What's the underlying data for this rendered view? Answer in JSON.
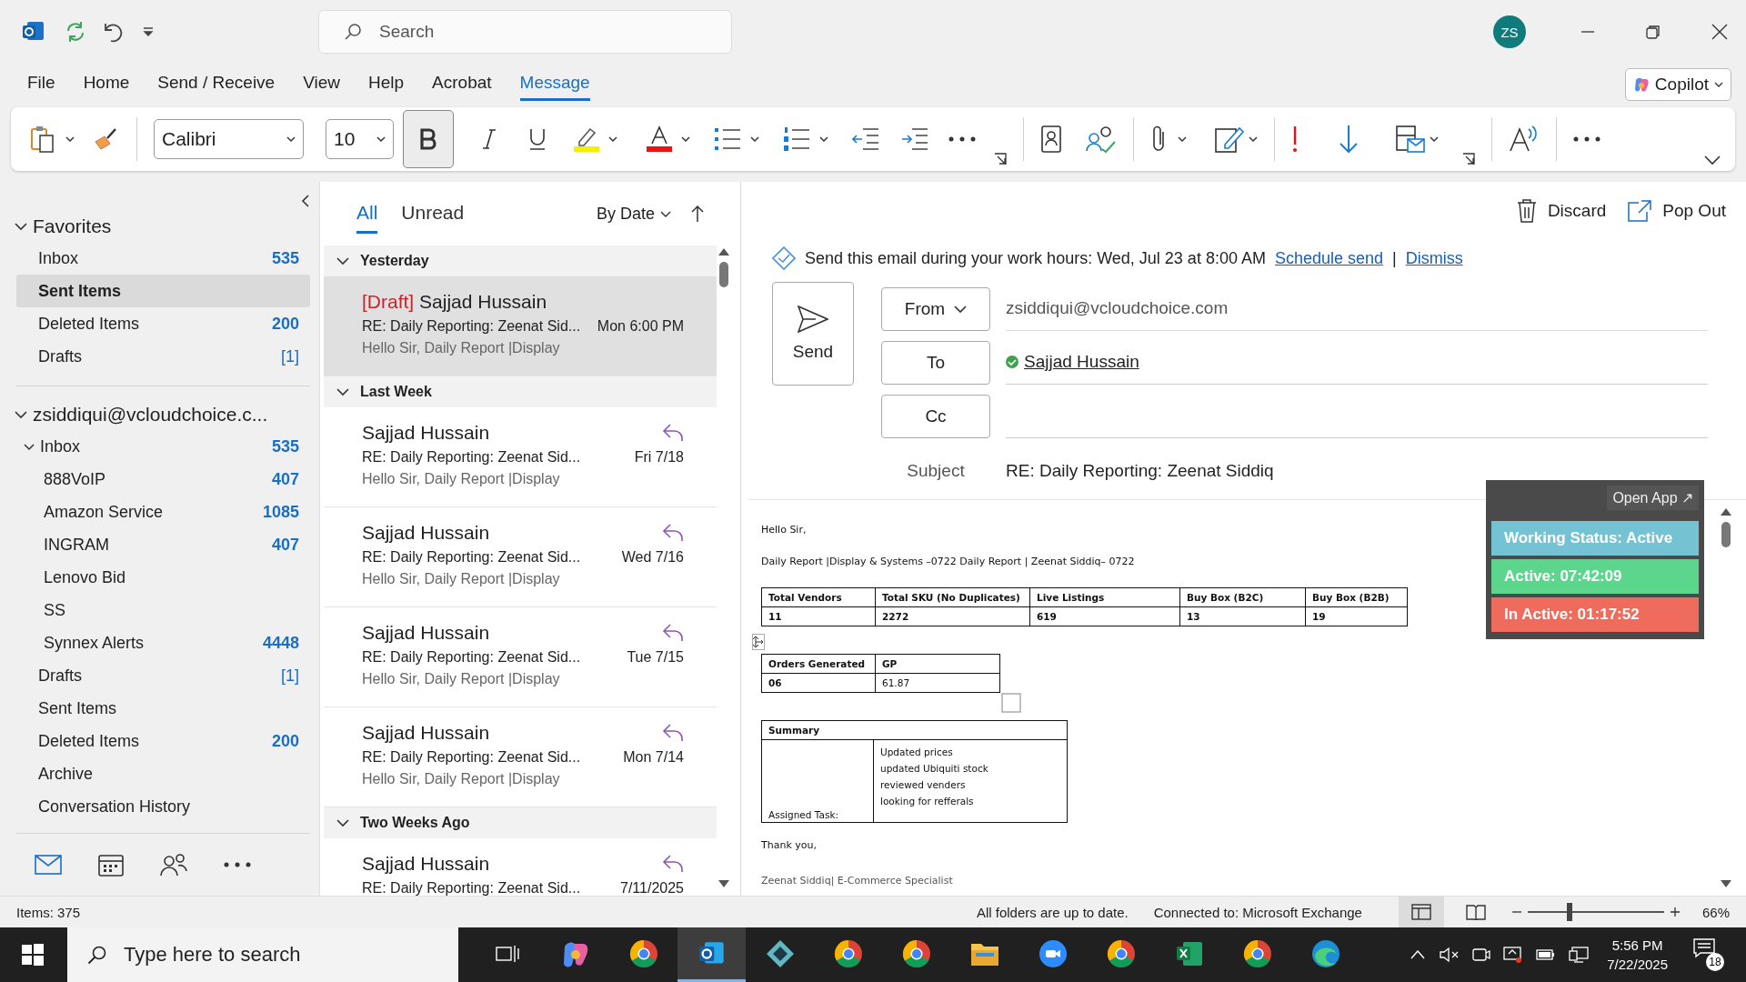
{
  "window": {
    "search_placeholder": "Search",
    "avatar": "ZS"
  },
  "menu": [
    {
      "label": "File",
      "selected": false
    },
    {
      "label": "Home",
      "selected": false
    },
    {
      "label": "Send / Receive",
      "selected": false
    },
    {
      "label": "View",
      "selected": false
    },
    {
      "label": "Help",
      "selected": false
    },
    {
      "label": "Acrobat",
      "selected": false
    },
    {
      "label": "Message",
      "selected": true
    }
  ],
  "copilot": "Copilot",
  "ribbon": {
    "font": "Calibri",
    "size": "10",
    "bold_active": true
  },
  "folders": {
    "favorites": {
      "title": "Favorites",
      "expanded": true,
      "items": [
        {
          "name": "Inbox",
          "count": "535",
          "kind": "unread",
          "selected": false
        },
        {
          "name": "Sent Items",
          "selected": true
        },
        {
          "name": "Deleted Items",
          "count": "200",
          "kind": "unread",
          "selected": false
        },
        {
          "name": "Drafts",
          "count": "[1]",
          "kind": "drafts",
          "selected": false
        }
      ]
    },
    "account": {
      "title": "zsiddiqui@vcloudchoice.c...",
      "expanded": true,
      "items": [
        {
          "name": "Inbox",
          "count": "535",
          "kind": "unread",
          "selected": false,
          "expanded": true,
          "children": [
            {
              "name": "888VoIP",
              "count": "407",
              "kind": "unread",
              "selected": false
            },
            {
              "name": "Amazon Service",
              "count": "1085",
              "kind": "unread",
              "selected": false
            },
            {
              "name": "INGRAM",
              "count": "407",
              "kind": "unread",
              "selected": false
            },
            {
              "name": "Lenovo Bid",
              "selected": false
            },
            {
              "name": "SS",
              "selected": false
            },
            {
              "name": "Synnex Alerts",
              "count": "4448",
              "kind": "unread",
              "selected": false
            }
          ]
        },
        {
          "name": "Drafts",
          "count": "[1]",
          "kind": "drafts",
          "selected": false
        },
        {
          "name": "Sent Items",
          "selected": false
        },
        {
          "name": "Deleted Items",
          "count": "200",
          "kind": "unread",
          "selected": false
        },
        {
          "name": "Archive",
          "selected": false
        },
        {
          "name": "Conversation History",
          "selected": false
        }
      ]
    }
  },
  "messages": {
    "filters": [
      {
        "label": "All",
        "selected": true
      },
      {
        "label": "Unread",
        "selected": false
      }
    ],
    "sort": "By Date",
    "groups": [
      {
        "title": "Yesterday",
        "expanded": true,
        "items": [
          {
            "tag": "[Draft]",
            "sender": "Sajjad Hussain",
            "subject": "RE: Daily Reporting: Zeenat Sid...",
            "date": "Mon 6:00 PM",
            "preview": "Hello Sir,  Daily Report |Display",
            "replied": false,
            "selected": true
          }
        ]
      },
      {
        "title": "Last Week",
        "expanded": true,
        "items": [
          {
            "sender": "Sajjad Hussain",
            "subject": "RE: Daily Reporting: Zeenat Sid...",
            "date": "Fri 7/18",
            "preview": "Hello Sir,  Daily Report |Display",
            "replied": true,
            "selected": false
          },
          {
            "sender": "Sajjad Hussain",
            "subject": "RE: Daily Reporting: Zeenat Sid...",
            "date": "Wed 7/16",
            "preview": "Hello Sir,  Daily Report |Display",
            "replied": true,
            "selected": false
          },
          {
            "sender": "Sajjad Hussain",
            "subject": "RE: Daily Reporting: Zeenat Sid...",
            "date": "Tue 7/15",
            "preview": "Hello Sir,  Daily Report |Display",
            "replied": true,
            "selected": false
          },
          {
            "sender": "Sajjad Hussain",
            "subject": "RE: Daily Reporting: Zeenat Sid...",
            "date": "Mon 7/14",
            "preview": "Hello Sir,  Daily Report |Display",
            "replied": true,
            "selected": false
          }
        ]
      },
      {
        "title": "Two Weeks Ago",
        "expanded": true,
        "items": [
          {
            "sender": "Sajjad Hussain",
            "subject": "RE: Daily Reporting: Zeenat Sid...",
            "date": "7/11/2025",
            "replied": true,
            "selected": false
          }
        ]
      }
    ]
  },
  "compose": {
    "discard": "Discard",
    "pop_out": "Pop Out",
    "notice": "Send this email during your work hours: Wed, Jul 23 at 8:00 AM",
    "schedule_link": "Schedule send",
    "separator": "|",
    "dismiss_link": "Dismiss",
    "send": "Send",
    "from_label": "From",
    "from_value": "zsiddiqui@vcloudchoice.com",
    "to_label": "To",
    "recipients": [
      {
        "name": "Sajjad Hussain"
      }
    ],
    "cc_label": "Cc",
    "subject_label": "Subject",
    "subject": "RE: Daily Reporting: Zeenat Siddiq"
  },
  "body": {
    "greeting": "Hello Sir,",
    "line": "Daily Report |Display & Systems –0722 Daily Report | Zeenat Siddiq– 0722",
    "table1": {
      "columns": [
        "Total Vendors",
        "Total SKU (No Duplicates)",
        "Live Listings",
        "Buy Box (B2C)",
        "Buy Box (B2B)"
      ],
      "rows": [
        [
          "11",
          "2272",
          "619",
          "13",
          "19"
        ]
      ]
    },
    "table2": {
      "columns": [
        "Orders Generated",
        "GP"
      ],
      "rows": [
        [
          "06",
          "61.87"
        ]
      ]
    },
    "summary": {
      "title": "Summary",
      "label": "Assigned Task:",
      "tasks": [
        "Updated prices",
        "updated Ubiquiti stock",
        "reviewed venders",
        "looking for refferals"
      ]
    },
    "closing": "Thank you,",
    "signature": "Zeenat Siddiq| E-Commerce Specialist"
  },
  "widget": {
    "open_app": "Open App ↗",
    "rows": [
      {
        "text": "Working Status: Active",
        "color": "#74c3d4"
      },
      {
        "text": "Active: 07:42:09",
        "color": "#5cd68d"
      },
      {
        "text": "In Active: 01:17:52",
        "color": "#ef6c5c"
      }
    ]
  },
  "status": {
    "items": "Items: 375",
    "sync": "All folders are up to date.",
    "connection": "Connected to: Microsoft Exchange",
    "zoom": {
      "level": 0.31,
      "reading": "66%"
    }
  },
  "taskbar": {
    "search_placeholder": "Type here to search",
    "apps": [
      {
        "kind": "taskview",
        "selected": false
      },
      {
        "kind": "copilot",
        "selected": false
      },
      {
        "kind": "chrome",
        "selected": false
      },
      {
        "kind": "outlook",
        "selected": true
      },
      {
        "kind": "diamond",
        "selected": false
      },
      {
        "kind": "chrome",
        "selected": false
      },
      {
        "kind": "chrome",
        "selected": false
      },
      {
        "kind": "files",
        "selected": false
      },
      {
        "kind": "zoom",
        "selected": false
      },
      {
        "kind": "chrome",
        "selected": false
      },
      {
        "kind": "excel",
        "selected": false
      },
      {
        "kind": "chrome",
        "selected": false
      },
      {
        "kind": "edge",
        "selected": false
      }
    ],
    "time": "5:56 PM",
    "date": "7/22/2025",
    "notifications": "18"
  }
}
